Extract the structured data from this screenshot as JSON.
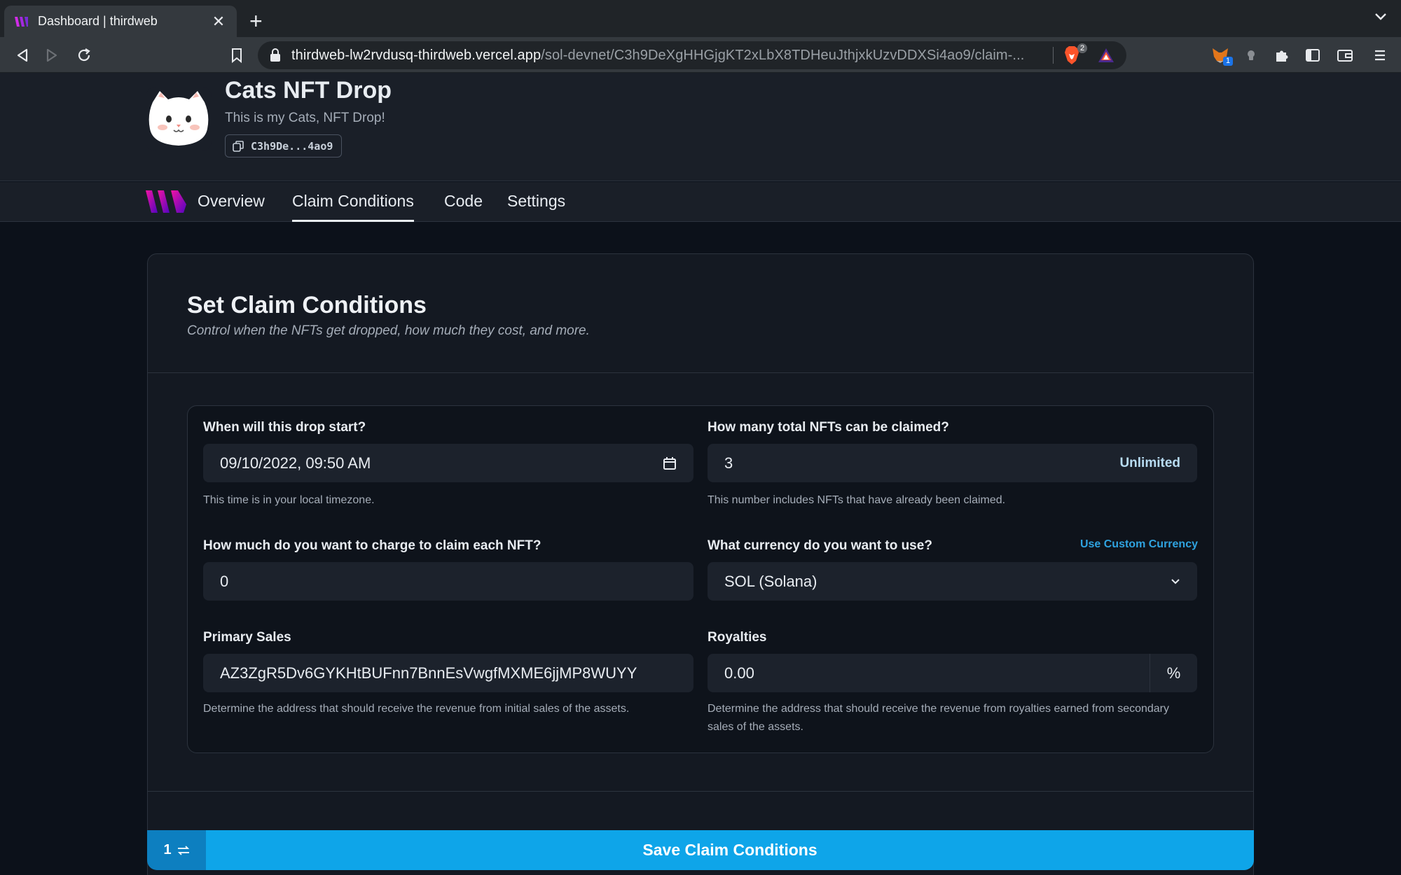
{
  "browser": {
    "tab_title": "Dashboard | thirdweb",
    "url_host": "thirdweb-lw2rvdusq-thirdweb.vercel.app",
    "url_path": "/sol-devnet/C3h9DeXgHHGjgKT2xLbX8TDHeuJthjxkUzvDDXSi4ao9/claim-...",
    "brave_shield_count": "2",
    "extension_badge": "1"
  },
  "header": {
    "title": "Cats NFT Drop",
    "subtitle": "This is my Cats, NFT Drop!",
    "address_short": "C3h9De...4ao9"
  },
  "nav": {
    "tabs": [
      {
        "label": "Overview",
        "active": false
      },
      {
        "label": "Claim Conditions",
        "active": true
      },
      {
        "label": "Code",
        "active": false
      },
      {
        "label": "Settings",
        "active": false
      }
    ]
  },
  "card": {
    "title": "Set Claim Conditions",
    "subtitle": "Control when the NFTs get dropped, how much they cost, and more."
  },
  "form": {
    "start": {
      "label": "When will this drop start?",
      "value": "09/10/2022, 09:50 AM",
      "help": "This time is in your local timezone."
    },
    "total": {
      "label": "How many total NFTs can be claimed?",
      "value": "3",
      "unlimited_label": "Unlimited",
      "help": "This number includes NFTs that have already been claimed."
    },
    "price": {
      "label": "How much do you want to charge to claim each NFT?",
      "value": "0"
    },
    "currency": {
      "label": "What currency do you want to use?",
      "custom_link": "Use Custom Currency",
      "value": "SOL (Solana)"
    },
    "primary_sales": {
      "label": "Primary Sales",
      "value": "AZ3ZgR5Dv6GYKHtBUFnn7BnnEsVwgfMXME6jjMP8WUYY",
      "help": "Determine the address that should receive the revenue from initial sales of the assets."
    },
    "royalties": {
      "label": "Royalties",
      "value": "0.00",
      "unit": "%",
      "help": "Determine the address that should receive the revenue from royalties earned from secondary sales of the assets."
    }
  },
  "footer": {
    "count_label": "1",
    "save_label": "Save Claim Conditions"
  },
  "colors": {
    "accent": "#0ea5e9",
    "link": "#2fa3e0",
    "background": "#0c111a"
  }
}
